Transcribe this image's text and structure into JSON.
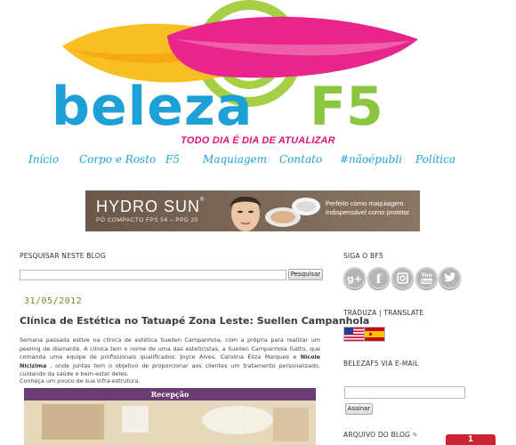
{
  "header": {
    "logo_word": "beleza",
    "logo_f5": "F5",
    "tagline": "TODO DIA É DIA DE ATUALIZAR"
  },
  "nav": {
    "items": [
      "Início",
      "Corpo e Rosto",
      "F5",
      "Maquiagem",
      "Contato",
      "#nãoépubli",
      "Política"
    ]
  },
  "banner": {
    "brand": "HYDRO SUN",
    "trademark": "®",
    "sub": "PÓ COMPACTO FPS 54 – PPD 20",
    "text_line1": "Perfeito como maquiagem.",
    "text_line2": "Indispensável como protetor."
  },
  "search": {
    "title": "PESQUISAR NESTE BLOG",
    "value": "",
    "button": "Pesquisar"
  },
  "post": {
    "date": "31/05/2012",
    "title": "Clínica de Estética no Tatuapé Zona Leste: Suellen Campanhola",
    "body_part1": "Semana passada estive na clínica de estética Suellen Campanhola, com a própria para realizar um peeling de diamante. A clínica tem o nome de uma das esteticistas, a Suellen Campanhola Gatto, que comanda uma equipe de profissionais qualificados: Joyce Alves, Carolina Eliza Marques e ",
    "body_bold": "Nicole Niclzima",
    "body_part2": " , onde juntas tem o objetivo de proporcionar aos clientes um tratamento personalizado, cuidando da saúde e bem-estar deles.",
    "line2": "Conheça um pouco de sua infra-estrutura.",
    "photo_caption": "Recepção"
  },
  "sidebar": {
    "follow_title": "SIGA O BF5",
    "social_icons": [
      "google-plus-icon",
      "facebook-icon",
      "instagram-icon",
      "youtube-icon",
      "twitter-icon"
    ],
    "youtube_label": "You Tube",
    "translate_title": "TRADUZA | TRANSLATE",
    "flags": [
      "us-flag-icon",
      "spain-flag-icon"
    ],
    "email_title": "BELEZAF5 VIA E-MAIL",
    "email_value": "",
    "email_button": "Assinar",
    "archive_title": "ARQUIVO DO BLOG",
    "archive_icon": "pencil-icon"
  },
  "badge": {
    "count": "1"
  },
  "colors": {
    "nav": "#1ca4d8",
    "tagline": "#e0127a",
    "logo_blue": "#1ca0d6",
    "logo_green": "#8cc63f",
    "date": "#6a8f2c"
  }
}
